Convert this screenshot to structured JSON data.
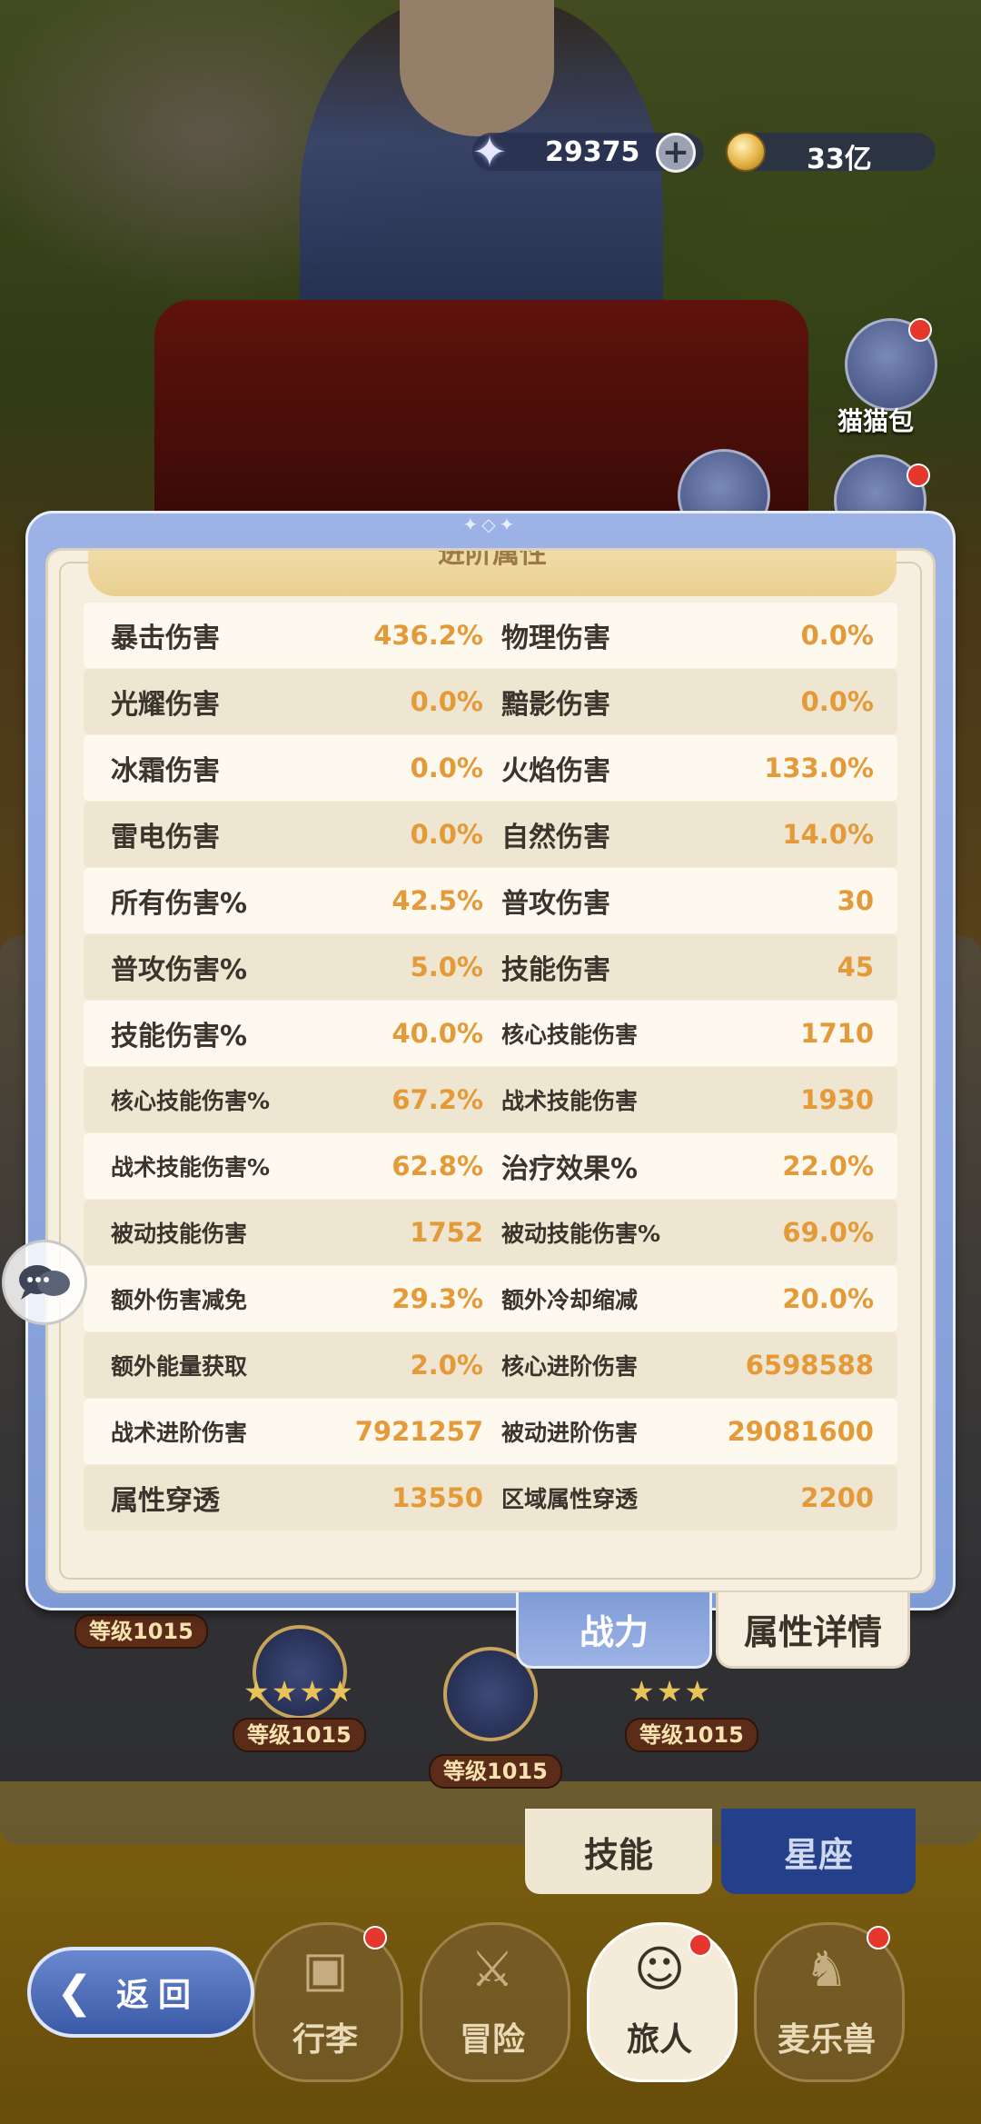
{
  "currency": {
    "gems": "29375",
    "gold": "33亿",
    "gem_icon": "star-gem-icon",
    "gold_icon": "gold-coin-icon"
  },
  "side_buttons": {
    "cat_bag_label": "猫猫包"
  },
  "panel": {
    "section_title": "进阶属性",
    "stats": [
      {
        "l1": "暴击伤害",
        "v1": "436.2%",
        "l2": "物理伤害",
        "v2": "0.0%"
      },
      {
        "l1": "光耀伤害",
        "v1": "0.0%",
        "l2": "黯影伤害",
        "v2": "0.0%"
      },
      {
        "l1": "冰霜伤害",
        "v1": "0.0%",
        "l2": "火焰伤害",
        "v2": "133.0%"
      },
      {
        "l1": "雷电伤害",
        "v1": "0.0%",
        "l2": "自然伤害",
        "v2": "14.0%"
      },
      {
        "l1": "所有伤害%",
        "v1": "42.5%",
        "l2": "普攻伤害",
        "v2": "30"
      },
      {
        "l1": "普攻伤害%",
        "v1": "5.0%",
        "l2": "技能伤害",
        "v2": "45"
      },
      {
        "l1": "技能伤害%",
        "v1": "40.0%",
        "l2": "核心技能伤害",
        "v2": "1710"
      },
      {
        "l1": "核心技能伤害%",
        "v1": "67.2%",
        "l2": "战术技能伤害",
        "v2": "1930"
      },
      {
        "l1": "战术技能伤害%",
        "v1": "62.8%",
        "l2": "治疗效果%",
        "v2": "22.0%"
      },
      {
        "l1": "被动技能伤害",
        "v1": "1752",
        "l2": "被动技能伤害%",
        "v2": "69.0%"
      },
      {
        "l1": "额外伤害减免",
        "v1": "29.3%",
        "l2": "额外冷却缩减",
        "v2": "20.0%"
      },
      {
        "l1": "额外能量获取",
        "v1": "2.0%",
        "l2": "核心进阶伤害",
        "v2": "6598588"
      },
      {
        "l1": "战术进阶伤害",
        "v1": "7921257",
        "l2": "被动进阶伤害",
        "v2": "29081600"
      },
      {
        "l1": "属性穿透",
        "v1": "13550",
        "l2": "区域属性穿透",
        "v2": "2200"
      }
    ],
    "tabs": {
      "power": "战力",
      "detail": "属性详情"
    }
  },
  "skill_tree": {
    "level_tags": [
      "等级1015",
      "等级1015",
      "等级1015",
      "等级1015"
    ],
    "tab_skill": "技能",
    "tab_constellation": "星座"
  },
  "bottom_nav": {
    "items": [
      "行李",
      "冒险",
      "旅人",
      "麦乐兽"
    ],
    "back_label": "返回"
  },
  "colors": {
    "value_orange": "#e49a38",
    "panel_blue": "#9db3e6",
    "panel_cream": "#f6efdf"
  }
}
